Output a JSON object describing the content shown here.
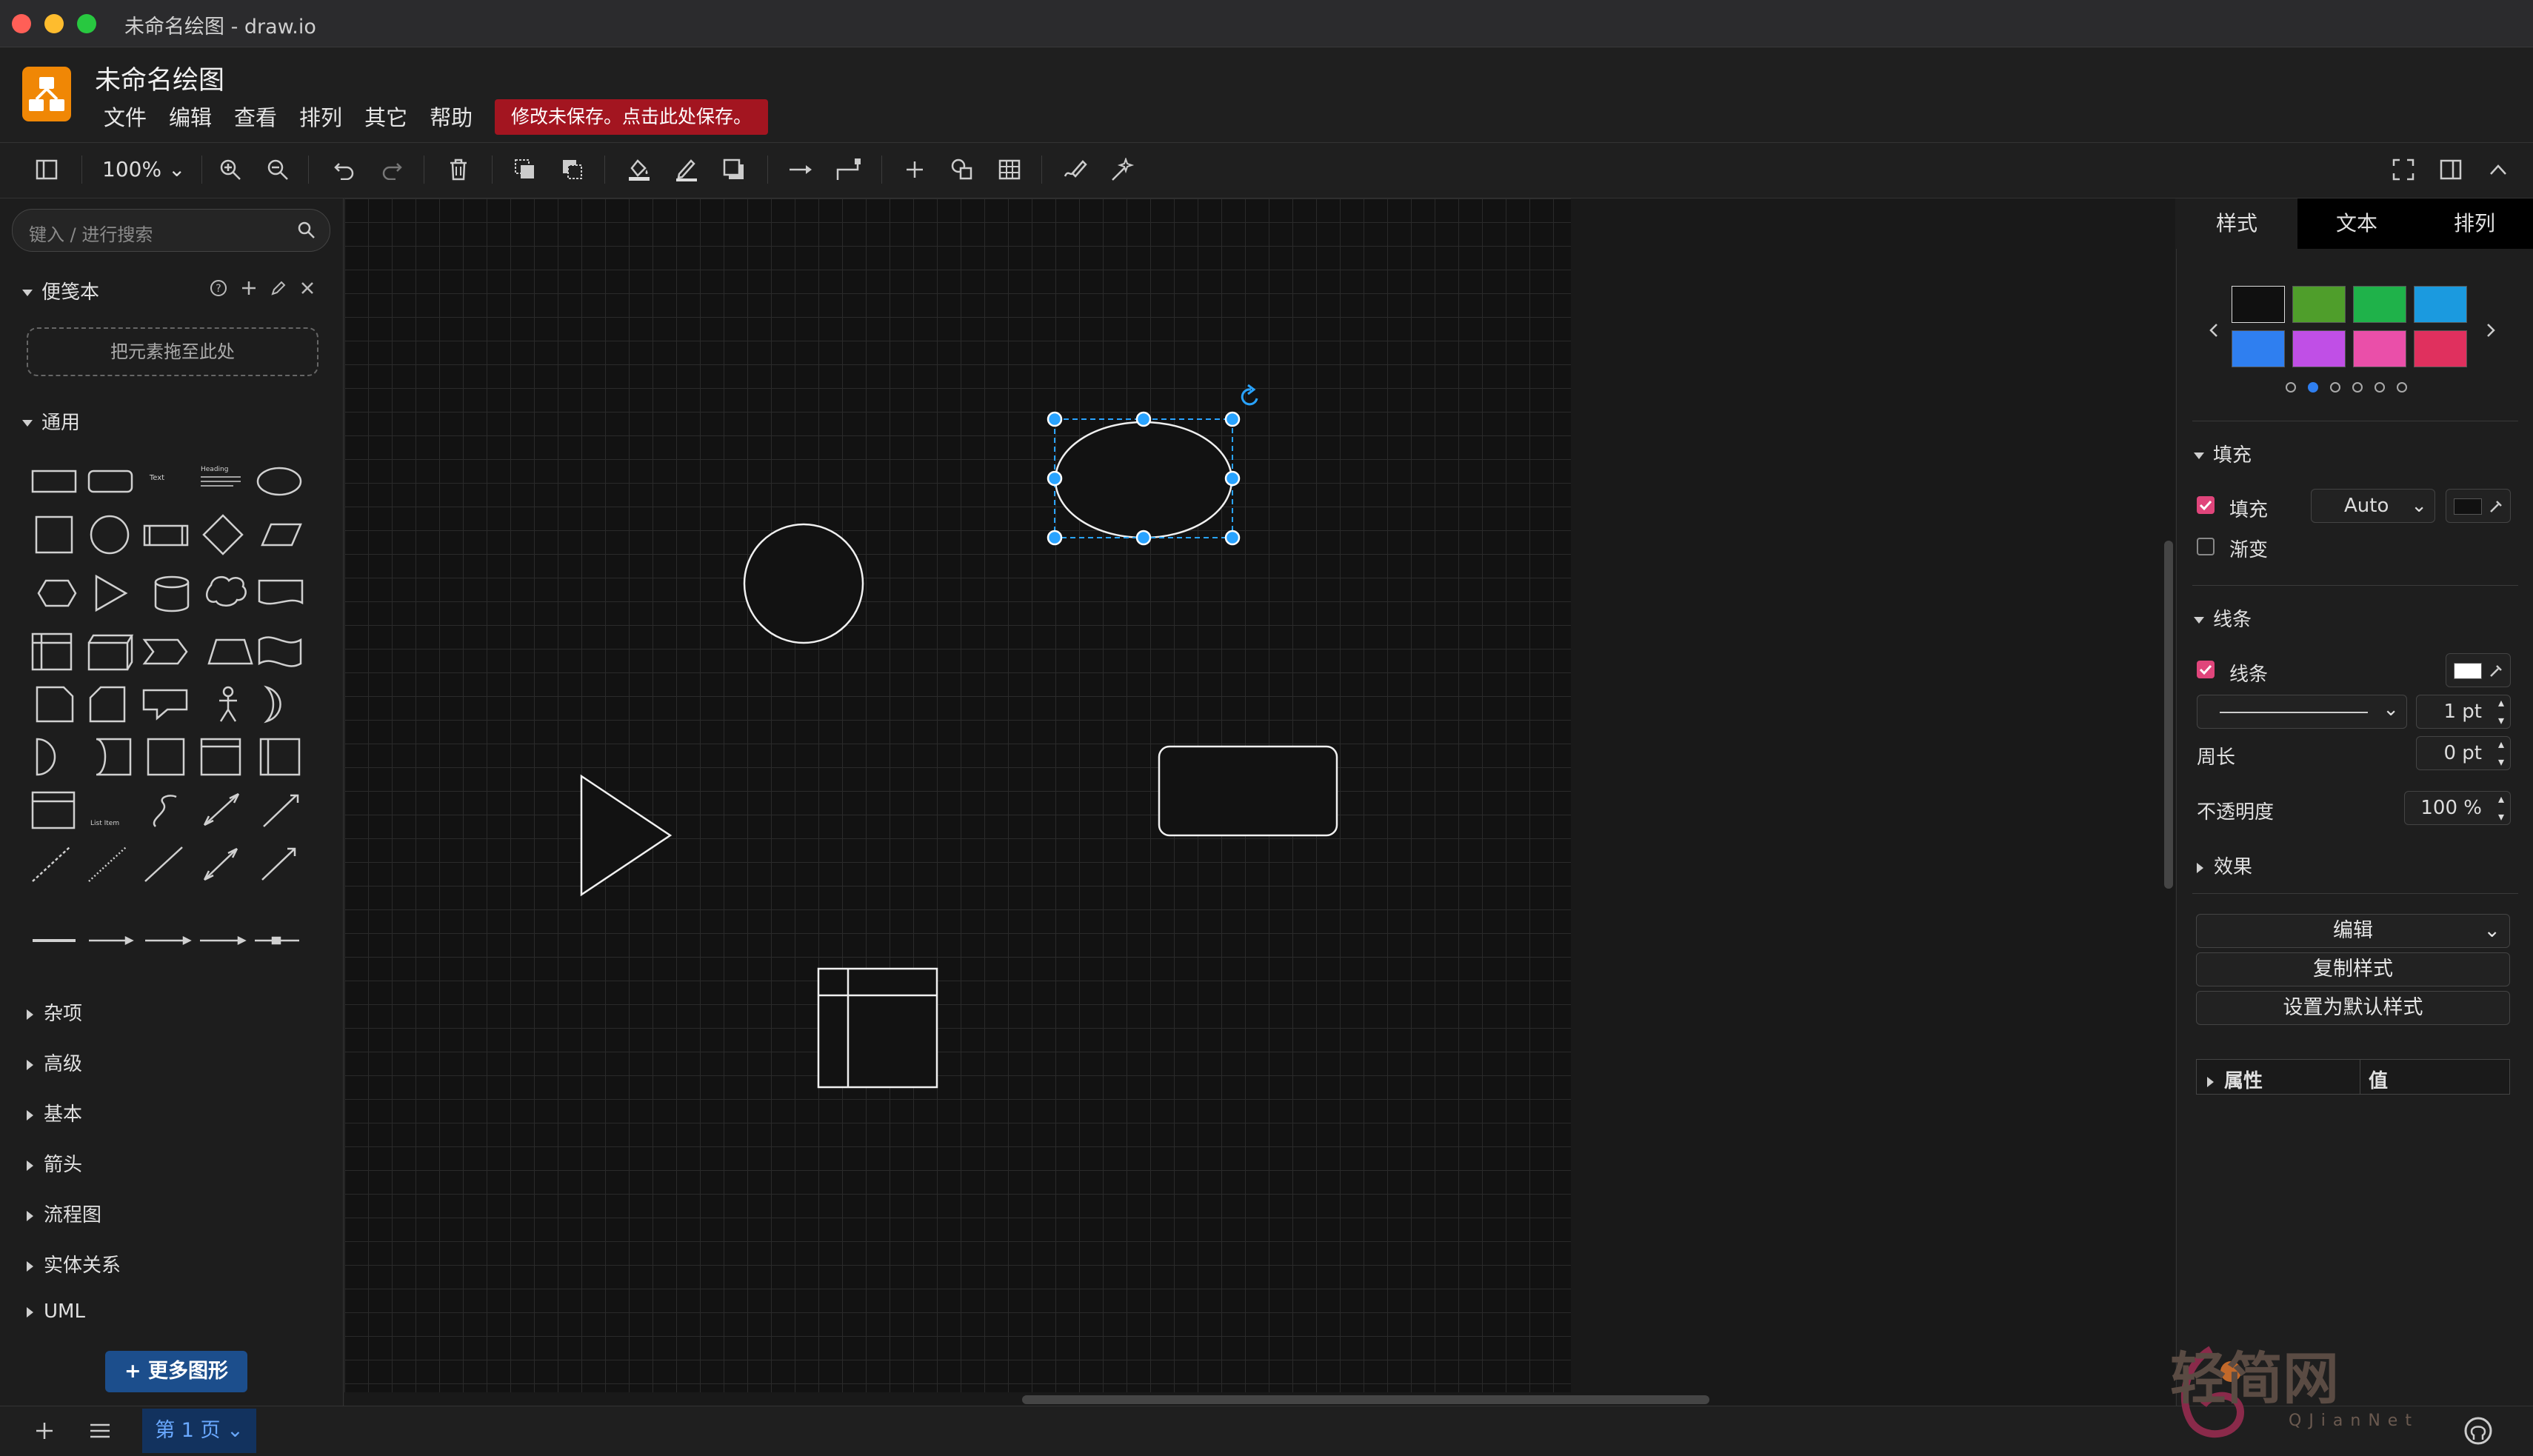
{
  "window": {
    "title": "未命名绘图 - draw.io"
  },
  "app": {
    "doc_title": "未命名绘图",
    "save_warning": "修改未保存。点击此处保存。"
  },
  "menu": [
    "文件",
    "编辑",
    "查看",
    "排列",
    "其它",
    "帮助"
  ],
  "toolbar": {
    "zoom": "100%"
  },
  "left_panel": {
    "search_placeholder": "键入 / 进行搜索",
    "scratchpad": {
      "title": "便笺本",
      "drop_hint": "把元素拖至此处"
    },
    "general": {
      "title": "通用"
    },
    "shape_text": {
      "text": "Text",
      "heading": "Heading",
      "list_item": "List Item"
    },
    "sections": [
      "杂项",
      "高级",
      "基本",
      "箭头",
      "流程图",
      "实体关系",
      "UML"
    ],
    "more_shapes": "+ 更多图形"
  },
  "right_panel": {
    "tabs": [
      "样式",
      "文本",
      "排列"
    ],
    "swatches": [
      "#101010",
      "#4f9e2b",
      "#1fb24a",
      "#1b9adf",
      "#2f7ff0",
      "#c04fe6",
      "#ea4fa9",
      "#e0305e"
    ],
    "fill_section": "填充",
    "fill_label": "填充",
    "fill_value": "Auto",
    "gradient_label": "渐变",
    "line_section": "线条",
    "line_label": "线条",
    "line_width": "1 pt",
    "perimeter_label": "周长",
    "perimeter_value": "0 pt",
    "opacity_label": "不透明度",
    "opacity_value": "100 %",
    "effects_label": "效果",
    "edit_button": "编辑",
    "copy_style_button": "复制样式",
    "set_default_button": "设置为默认样式",
    "prop_header": "属性",
    "value_header": "值"
  },
  "bottom": {
    "page_tab": "第 1 页"
  },
  "watermark": {
    "text": "轻简网",
    "sub": "QJianNet"
  }
}
